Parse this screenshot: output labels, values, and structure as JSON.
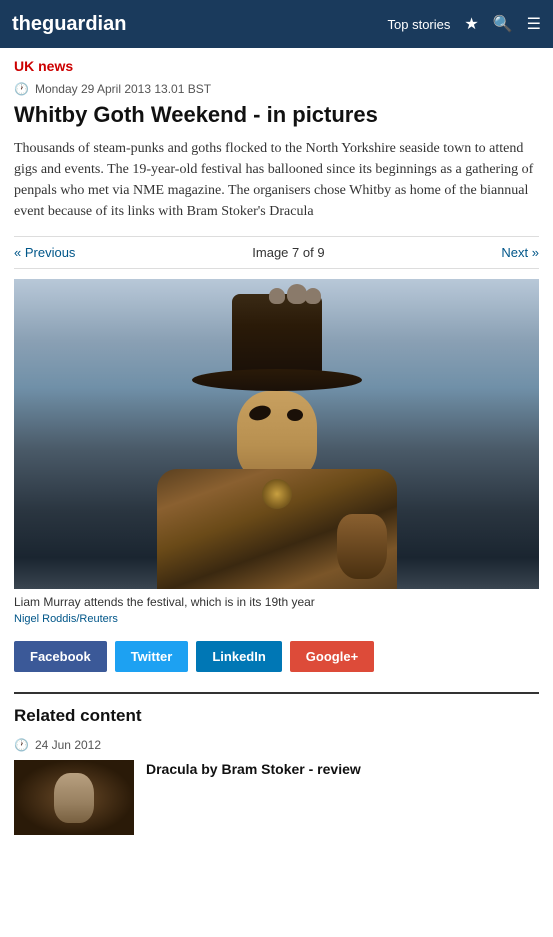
{
  "header": {
    "logo_regular": "the",
    "logo_bold": "guardian",
    "nav_label": "Top stories",
    "search_icon": "🔍",
    "menu_icon": "☰",
    "star_icon": "★"
  },
  "article": {
    "section": "UK news",
    "date": "Monday 29 April 2013 13.01 BST",
    "title": "Whitby Goth Weekend - in pictures",
    "body": "Thousands of steam-punks and goths flocked to the North Yorkshire seaside town to attend gigs and events. The 19-year-old festival has ballooned since its beginnings as a gathering of penpals who met via NME magazine. The organisers chose Whitby as home of the biannual event because of its links with Bram Stoker's Dracula",
    "nav_prev": "« Previous",
    "nav_next": "Next »",
    "image_counter": "Image 7 of 9",
    "caption": "Liam Murray attends the festival, which is in its 19th year",
    "credit": "Nigel Roddis/Reuters"
  },
  "social": {
    "facebook": "Facebook",
    "twitter": "Twitter",
    "linkedin": "LinkedIn",
    "googleplus": "Google+"
  },
  "related": {
    "section_title": "Related content",
    "date": "24 Jun 2012",
    "article_title": "Dracula by Bram Stoker - review"
  }
}
